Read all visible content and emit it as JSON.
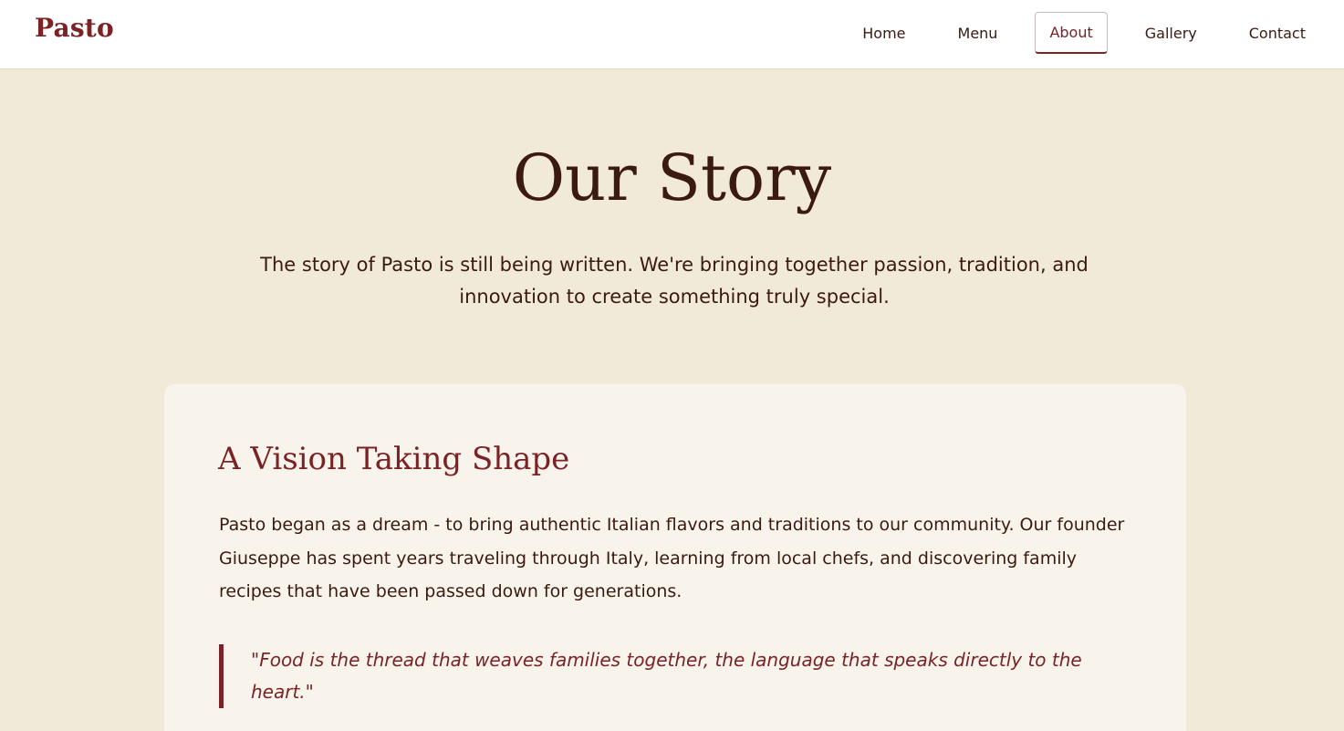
{
  "header": {
    "logo": "Pasto",
    "nav": [
      {
        "label": "Home",
        "active": false
      },
      {
        "label": "Menu",
        "active": false
      },
      {
        "label": "About",
        "active": true
      },
      {
        "label": "Gallery",
        "active": false
      },
      {
        "label": "Contact",
        "active": false
      }
    ]
  },
  "hero": {
    "title": "Our Story",
    "subtitle": "The story of Pasto is still being written. We're bringing together passion, tradition, and innovation to create something truly special."
  },
  "story_card": {
    "heading": "A Vision Taking Shape",
    "paragraph": "Pasto began as a dream - to bring authentic Italian flavors and traditions to our community. Our founder Giuseppe has spent years traveling through Italy, learning from local chefs, and discovering family recipes that have been passed down for generations.",
    "quote": "\"Food is the thread that weaves families together, the language that speaks directly to the heart.\""
  },
  "colors": {
    "brand": "#7b2226",
    "page_background": "#f2ead8",
    "card_background": "#f8f4ec",
    "text": "#3b1a10"
  }
}
